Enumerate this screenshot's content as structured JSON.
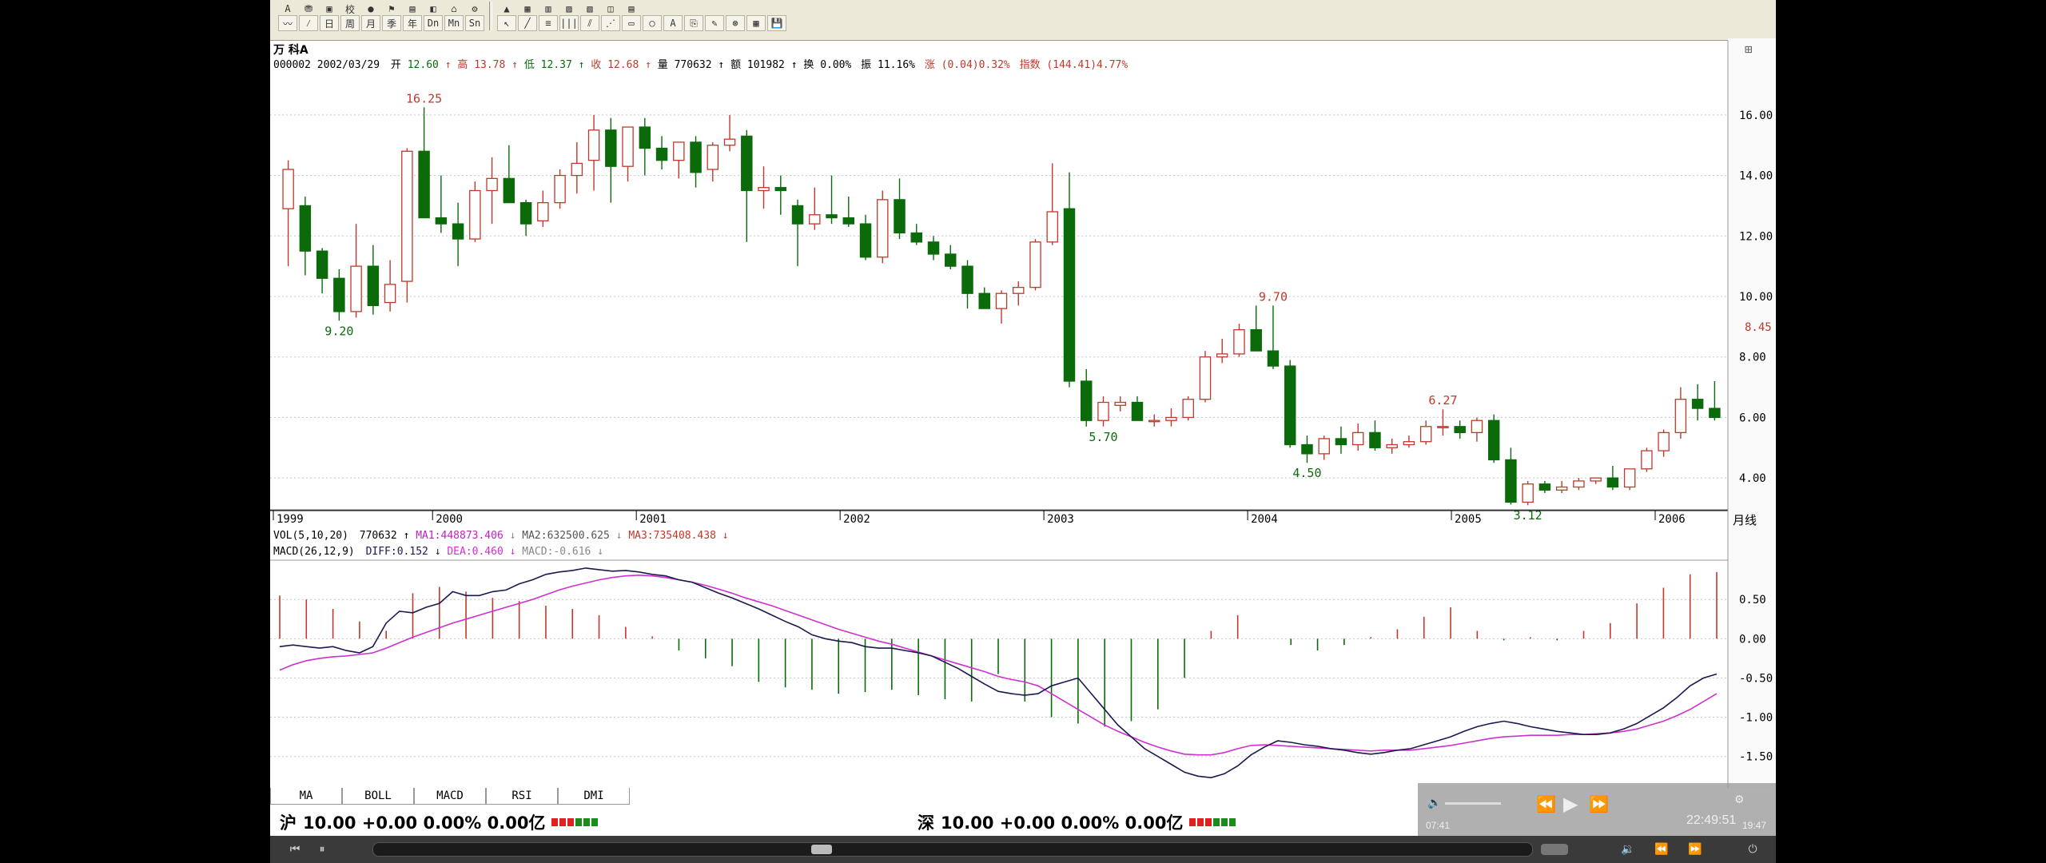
{
  "toolbar": {
    "row1": [
      "A",
      "⛃",
      "▣",
      "校",
      "●",
      "⚑",
      "▤",
      "◧",
      "⌂",
      "⚙",
      "▲",
      "▦",
      "▥",
      "▨",
      "▧",
      "◫",
      "▤"
    ],
    "row2": [
      "〰",
      "⁄",
      "日",
      "周",
      "月",
      "季",
      "年",
      "Dn",
      "Mn",
      "Sn",
      "↖",
      "╱",
      "≡",
      "|||",
      "⫽",
      "⋰",
      "▭",
      "○",
      "A",
      "⎘",
      "✎",
      "⊛",
      "▦",
      "💾"
    ]
  },
  "header": {
    "stock_name": "万 科A",
    "info_date": "000002 2002/03/29",
    "open_label": "开",
    "open": "12.60",
    "high_label": "高",
    "high": "13.78",
    "low_label": "低",
    "low": "12.37",
    "close_label": "收",
    "close": "12.68",
    "vol_label": "量",
    "vol": "770632",
    "amt_label": "额",
    "amt": "101982",
    "turn_label": "换",
    "turn": "0.00%",
    "amp_label": "振",
    "amp": "11.16%",
    "chg_label": "涨",
    "chg": "(0.04)0.32%",
    "idx_label": "指数",
    "idx": "(144.41)4.77%"
  },
  "vol_line": {
    "label": "VOL(5,10,20)",
    "vol": "770632",
    "ma1": "MA1:448873.406",
    "ma2": "MA2:632500.625",
    "ma3": "MA3:735408.438"
  },
  "macd_line": {
    "label": "MACD(26,12,9)",
    "diff": "DIFF:0.152",
    "dea": "DEA:0.460",
    "macd": "MACD:-0.616"
  },
  "period_label": "月线",
  "last_price_marker": "8.45",
  "indicator_tabs": [
    "MA",
    "BOLL",
    "MACD",
    "RSI",
    "DMI"
  ],
  "status_bar": {
    "sh": {
      "name": "沪",
      "text": "10.00 +0.00 0.00% 0.00亿"
    },
    "sz": {
      "name": "深",
      "text": "10.00 +0.00 0.00% 0.00亿"
    }
  },
  "player": {
    "elapsed": "07:41",
    "clock": "22:49:51",
    "duration": "19:47"
  },
  "colors": {
    "up": "#c0392b",
    "down": "#0b6b0b",
    "grid": "#c8c8c8",
    "diff": "#1a1a50",
    "dea": "#d030d0"
  },
  "chart_data": [
    {
      "type": "candlestick",
      "title": "万 科A",
      "period": "月线",
      "years": [
        "1999",
        "2000",
        "2001",
        "2002",
        "2003",
        "2004",
        "2005",
        "2006"
      ],
      "y_ticks": [
        "4.00",
        "6.00",
        "8.00",
        "10.00",
        "12.00",
        "14.00",
        "16.00"
      ],
      "ylim": [
        3.0,
        17.0
      ],
      "annotations": [
        {
          "label": "16.25",
          "bar": 8,
          "pos": "top"
        },
        {
          "label": "9.20",
          "bar": 3,
          "pos": "bottom"
        },
        {
          "label": "9.70",
          "bar": 58,
          "pos": "top"
        },
        {
          "label": "5.70",
          "bar": 48,
          "pos": "bottom"
        },
        {
          "label": "4.50",
          "bar": 60,
          "pos": "bottom"
        },
        {
          "label": "6.27",
          "bar": 68,
          "pos": "top"
        },
        {
          "label": "3.12",
          "bar": 73,
          "pos": "bottom"
        }
      ],
      "ohlc": [
        [
          12.9,
          14.5,
          11.0,
          14.2
        ],
        [
          13.0,
          13.3,
          10.7,
          11.5
        ],
        [
          11.5,
          11.6,
          10.1,
          10.6
        ],
        [
          10.6,
          10.9,
          9.2,
          9.5
        ],
        [
          9.5,
          12.4,
          9.3,
          11.0
        ],
        [
          11.0,
          11.7,
          9.4,
          9.7
        ],
        [
          9.8,
          11.2,
          9.5,
          10.4
        ],
        [
          10.5,
          14.9,
          9.8,
          14.8
        ],
        [
          14.8,
          16.25,
          12.6,
          12.6
        ],
        [
          12.6,
          14.0,
          12.1,
          12.4
        ],
        [
          12.4,
          13.1,
          11.0,
          11.9
        ],
        [
          11.9,
          13.8,
          11.8,
          13.5
        ],
        [
          13.5,
          14.6,
          12.4,
          13.9
        ],
        [
          13.9,
          15.0,
          13.2,
          13.1
        ],
        [
          13.1,
          13.2,
          12.0,
          12.4
        ],
        [
          12.5,
          13.5,
          12.3,
          13.1
        ],
        [
          13.1,
          14.2,
          12.9,
          14.0
        ],
        [
          14.0,
          15.1,
          13.4,
          14.4
        ],
        [
          14.5,
          16.0,
          13.5,
          15.5
        ],
        [
          15.5,
          15.9,
          13.1,
          14.3
        ],
        [
          14.3,
          15.5,
          13.8,
          15.6
        ],
        [
          15.6,
          15.9,
          14.0,
          14.9
        ],
        [
          14.9,
          15.3,
          14.2,
          14.5
        ],
        [
          14.5,
          15.1,
          13.9,
          15.1
        ],
        [
          15.1,
          15.3,
          13.6,
          14.1
        ],
        [
          14.2,
          15.1,
          13.8,
          15.0
        ],
        [
          15.0,
          16.0,
          14.8,
          15.2
        ],
        [
          15.3,
          15.5,
          11.8,
          13.5
        ],
        [
          13.5,
          14.3,
          12.9,
          13.6
        ],
        [
          13.6,
          14.0,
          12.7,
          13.5
        ],
        [
          13.0,
          13.2,
          11.0,
          12.4
        ],
        [
          12.4,
          13.6,
          12.2,
          12.7
        ],
        [
          12.7,
          14.0,
          12.4,
          12.6
        ],
        [
          12.6,
          13.3,
          12.3,
          12.4
        ],
        [
          12.4,
          12.7,
          11.2,
          11.3
        ],
        [
          11.3,
          13.5,
          11.1,
          13.2
        ],
        [
          13.2,
          13.9,
          11.9,
          12.1
        ],
        [
          12.1,
          12.4,
          11.7,
          11.8
        ],
        [
          11.8,
          12.0,
          11.2,
          11.4
        ],
        [
          11.4,
          11.7,
          10.9,
          11.0
        ],
        [
          11.0,
          11.2,
          9.6,
          10.1
        ],
        [
          10.1,
          10.3,
          9.6,
          9.6
        ],
        [
          9.6,
          10.2,
          9.1,
          10.1
        ],
        [
          10.1,
          10.5,
          9.7,
          10.3
        ],
        [
          10.3,
          11.9,
          10.2,
          11.8
        ],
        [
          11.8,
          14.4,
          11.7,
          12.8
        ],
        [
          12.9,
          14.1,
          7.0,
          7.2
        ],
        [
          7.2,
          7.6,
          5.7,
          5.9
        ],
        [
          5.9,
          6.7,
          5.7,
          6.5
        ],
        [
          6.4,
          6.7,
          6.2,
          6.5
        ],
        [
          6.5,
          6.7,
          5.9,
          5.9
        ],
        [
          5.9,
          6.1,
          5.7,
          5.9
        ],
        [
          5.9,
          6.3,
          5.7,
          6.0
        ],
        [
          6.0,
          6.7,
          5.9,
          6.6
        ],
        [
          6.6,
          8.2,
          6.5,
          8.0
        ],
        [
          8.0,
          8.6,
          7.8,
          8.1
        ],
        [
          8.1,
          9.1,
          8.0,
          8.9
        ],
        [
          8.9,
          9.7,
          8.4,
          8.2
        ],
        [
          8.2,
          9.7,
          7.6,
          7.7
        ],
        [
          7.7,
          7.9,
          5.0,
          5.1
        ],
        [
          5.1,
          5.4,
          4.5,
          4.8
        ],
        [
          4.8,
          5.4,
          4.6,
          5.3
        ],
        [
          5.3,
          5.7,
          4.8,
          5.1
        ],
        [
          5.1,
          5.8,
          4.9,
          5.5
        ],
        [
          5.5,
          5.9,
          4.9,
          5.0
        ],
        [
          5.0,
          5.3,
          4.8,
          5.1
        ],
        [
          5.1,
          5.4,
          5.0,
          5.2
        ],
        [
          5.2,
          5.9,
          5.1,
          5.7
        ],
        [
          5.7,
          6.27,
          5.4,
          5.7
        ],
        [
          5.7,
          5.9,
          5.3,
          5.5
        ],
        [
          5.5,
          6.0,
          5.2,
          5.9
        ],
        [
          5.9,
          6.1,
          4.5,
          4.6
        ],
        [
          4.6,
          5.0,
          3.12,
          3.2
        ],
        [
          3.2,
          3.9,
          3.1,
          3.8
        ],
        [
          3.8,
          3.9,
          3.5,
          3.6
        ],
        [
          3.6,
          3.9,
          3.5,
          3.7
        ],
        [
          3.7,
          4.0,
          3.6,
          3.9
        ],
        [
          3.9,
          4.0,
          3.8,
          4.0
        ],
        [
          4.0,
          4.4,
          3.6,
          3.7
        ],
        [
          3.7,
          4.3,
          3.6,
          4.3
        ],
        [
          4.3,
          5.0,
          4.2,
          4.9
        ],
        [
          4.9,
          5.6,
          4.7,
          5.5
        ],
        [
          5.5,
          7.0,
          5.3,
          6.6
        ],
        [
          6.6,
          7.1,
          5.9,
          6.3
        ],
        [
          6.3,
          7.2,
          5.9,
          6.0
        ]
      ]
    },
    {
      "type": "line",
      "title": "MACD(26,12,9)",
      "y_ticks": [
        "-1.50",
        "-1.00",
        "-0.50",
        "0.00",
        "0.50"
      ],
      "ylim": [
        -1.9,
        0.95
      ],
      "series": [
        {
          "name": "DIFF",
          "values": [
            -0.1,
            -0.08,
            -0.1,
            -0.12,
            -0.1,
            -0.15,
            -0.18,
            -0.1,
            0.2,
            0.35,
            0.33,
            0.4,
            0.45,
            0.6,
            0.55,
            0.55,
            0.6,
            0.62,
            0.7,
            0.75,
            0.82,
            0.85,
            0.87,
            0.9,
            0.88,
            0.86,
            0.87,
            0.85,
            0.82,
            0.8,
            0.75,
            0.72,
            0.65,
            0.58,
            0.52,
            0.45,
            0.38,
            0.3,
            0.22,
            0.15,
            0.05,
            0.0,
            -0.03,
            -0.05,
            -0.1,
            -0.12,
            -0.12,
            -0.15,
            -0.18,
            -0.22,
            -0.3,
            -0.38,
            -0.48,
            -0.58,
            -0.67,
            -0.7,
            -0.72,
            -0.7,
            -0.6,
            -0.55,
            -0.5,
            -0.7,
            -0.9,
            -1.1,
            -1.25,
            -1.4,
            -1.5,
            -1.6,
            -1.7,
            -1.75,
            -1.77,
            -1.72,
            -1.62,
            -1.48,
            -1.38,
            -1.3,
            -1.32,
            -1.35,
            -1.37,
            -1.4,
            -1.42,
            -1.45,
            -1.47,
            -1.45,
            -1.42,
            -1.4,
            -1.35,
            -1.3,
            -1.25,
            -1.18,
            -1.12,
            -1.08,
            -1.05,
            -1.08,
            -1.12,
            -1.15,
            -1.18,
            -1.2,
            -1.22,
            -1.22,
            -1.2,
            -1.15,
            -1.08,
            -0.98,
            -0.88,
            -0.75,
            -0.6,
            -0.5,
            -0.45
          ]
        },
        {
          "name": "DEA",
          "values": [
            -0.4,
            -0.33,
            -0.28,
            -0.25,
            -0.23,
            -0.22,
            -0.2,
            -0.18,
            -0.12,
            -0.05,
            0.02,
            0.08,
            0.14,
            0.2,
            0.25,
            0.3,
            0.35,
            0.4,
            0.45,
            0.5,
            0.56,
            0.62,
            0.67,
            0.71,
            0.75,
            0.78,
            0.8,
            0.81,
            0.8,
            0.78,
            0.75,
            0.72,
            0.68,
            0.63,
            0.58,
            0.52,
            0.47,
            0.42,
            0.36,
            0.3,
            0.24,
            0.18,
            0.12,
            0.07,
            0.02,
            -0.03,
            -0.07,
            -0.12,
            -0.17,
            -0.22,
            -0.27,
            -0.32,
            -0.37,
            -0.42,
            -0.48,
            -0.52,
            -0.55,
            -0.6,
            -0.7,
            -0.8,
            -0.9,
            -1.0,
            -1.1,
            -1.18,
            -1.25,
            -1.32,
            -1.38,
            -1.43,
            -1.47,
            -1.48,
            -1.48,
            -1.45,
            -1.4,
            -1.36,
            -1.35,
            -1.36,
            -1.37,
            -1.38,
            -1.39,
            -1.4,
            -1.41,
            -1.42,
            -1.43,
            -1.42,
            -1.42,
            -1.42,
            -1.4,
            -1.38,
            -1.36,
            -1.33,
            -1.3,
            -1.27,
            -1.25,
            -1.24,
            -1.23,
            -1.23,
            -1.23,
            -1.22,
            -1.22,
            -1.21,
            -1.2,
            -1.18,
            -1.15,
            -1.1,
            -1.05,
            -0.98,
            -0.9,
            -0.8,
            -0.7
          ]
        },
        {
          "name": "MACD",
          "values": [
            0.55,
            0.52,
            0.5,
            0.45,
            0.38,
            0.3,
            0.22,
            0.15,
            0.1,
            0.05,
            0.58,
            0.62,
            0.66,
            0.7,
            0.6,
            0.55,
            0.52,
            0.5,
            0.48,
            0.45,
            0.42,
            0.4,
            0.38,
            0.35,
            0.3,
            0.22,
            0.15,
            0.08,
            0.03,
            -0.05,
            -0.15,
            -0.2,
            -0.25,
            -0.3,
            -0.35,
            -0.4,
            -0.55,
            -0.6,
            -0.62,
            -0.64,
            -0.65,
            -0.66,
            -0.7,
            -0.73,
            -0.68,
            -0.62,
            -0.65,
            -0.7,
            -0.72,
            -0.75,
            -0.77,
            -0.78,
            -0.8,
            -0.82,
            -0.45,
            -0.35,
            -0.8,
            -0.9,
            -1.0,
            -1.05,
            -1.08,
            -1.1,
            -1.12,
            -1.1,
            -1.05,
            -1.0,
            -0.9,
            -0.7,
            -0.5,
            -0.3,
            0.1,
            0.2,
            0.3,
            0.38,
            0.0,
            -0.02,
            -0.08,
            -0.12,
            -0.15,
            -0.12,
            -0.08,
            -0.05,
            0.02,
            0.05,
            0.12,
            0.2,
            0.28,
            0.35,
            0.4,
            0.3,
            0.1,
            0.05,
            -0.02,
            0.0,
            0.02,
            0.0,
            -0.02,
            0.05,
            0.1,
            0.15,
            0.2,
            0.3,
            0.45,
            0.55,
            0.65,
            0.78,
            0.82,
            0.85,
            0.85
          ]
        }
      ]
    }
  ]
}
